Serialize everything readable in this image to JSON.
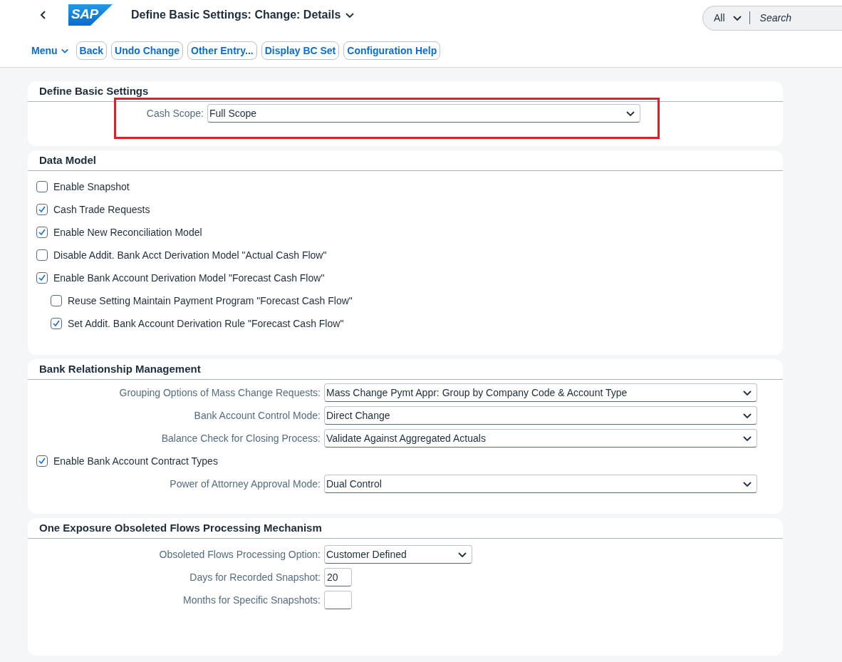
{
  "header": {
    "logo": "SAP",
    "title": "Define Basic Settings: Change: Details",
    "search": {
      "scope": "All",
      "placeholder": "Search"
    }
  },
  "toolbar": {
    "menu": "Menu",
    "buttons": [
      "Back",
      "Undo Change",
      "Other Entry...",
      "Display BC Set",
      "Configuration Help"
    ]
  },
  "sections": [
    {
      "title": "Define Basic Settings",
      "rows": [
        {
          "kind": "select",
          "label": "Cash Scope:",
          "value": "Full Scope",
          "highlighted": true
        }
      ]
    },
    {
      "title": "Data Model",
      "rows": [
        {
          "kind": "checkbox",
          "label": "Enable Snapshot",
          "checked": false
        },
        {
          "kind": "checkbox",
          "label": "Cash Trade Requests",
          "checked": true
        },
        {
          "kind": "checkbox",
          "label": "Enable New Reconciliation Model",
          "checked": true
        },
        {
          "kind": "checkbox",
          "label": "Disable Addit. Bank Acct Derivation Model \"Actual Cash Flow\"",
          "checked": false
        },
        {
          "kind": "checkbox",
          "label": "Enable Bank Account Derivation Model \"Forecast Cash Flow\"",
          "checked": true,
          "children": [
            {
              "kind": "checkbox",
              "label": "Reuse Setting Maintain Payment Program \"Forecast Cash Flow\"",
              "checked": false
            },
            {
              "kind": "checkbox",
              "label": "Set Addit. Bank Account Derivation Rule \"Forecast Cash Flow\"",
              "checked": true
            }
          ]
        }
      ]
    },
    {
      "title": "Bank Relationship Management",
      "rows": [
        {
          "kind": "select",
          "label": "Grouping Options of Mass Change Requests:",
          "value": "Mass Change Pymt Appr: Group by Company Code & Account Type"
        },
        {
          "kind": "select",
          "label": "Bank Account Control Mode:",
          "value": "Direct Change"
        },
        {
          "kind": "select",
          "label": "Balance Check for Closing Process:",
          "value": "Validate Against Aggregated Actuals"
        },
        {
          "kind": "checkbox",
          "label": "Enable Bank Account Contract Types",
          "checked": true
        },
        {
          "kind": "select",
          "label": "Power of Attorney Approval Mode:",
          "value": "Dual Control"
        }
      ]
    },
    {
      "title": "One Exposure Obsoleted Flows Processing Mechanism",
      "rows": [
        {
          "kind": "select",
          "label": "Obsoleted Flows Processing Option:",
          "value": "Customer Defined"
        },
        {
          "kind": "input",
          "label": "Days for Recorded Snapshot:",
          "value": "20"
        },
        {
          "kind": "input",
          "label": "Months for Specific Snapshots:"
        }
      ]
    }
  ]
}
